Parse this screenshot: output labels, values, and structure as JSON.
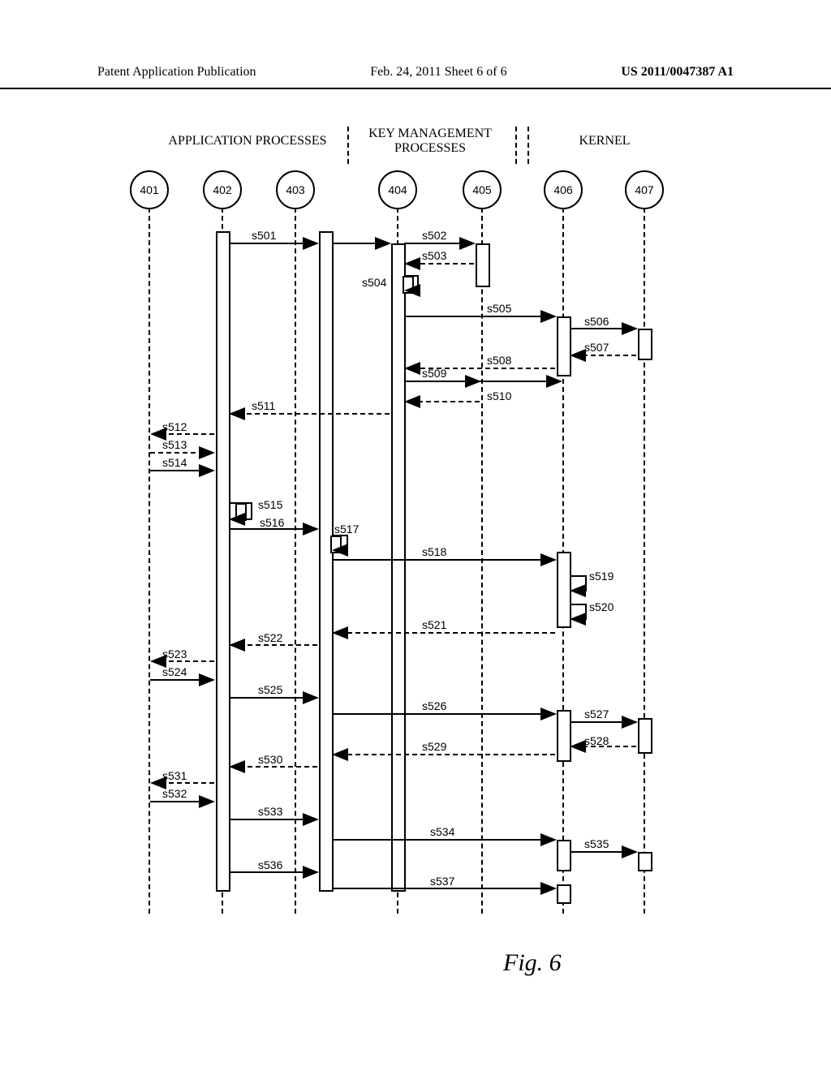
{
  "header": {
    "left": "Patent Application Publication",
    "center": "Feb. 24, 2011  Sheet 6 of 6",
    "right": "US 2011/0047387 A1"
  },
  "sections": {
    "app": "APPLICATION PROCESSES",
    "key": "KEY MANAGEMENT\nPROCESSES",
    "kernel": "KERNEL"
  },
  "lifelines": {
    "l401": "401",
    "l402": "402",
    "l403": "403",
    "l404": "404",
    "l405": "405",
    "l406": "406",
    "l407": "407"
  },
  "messages": {
    "s501": "s501",
    "s502": "s502",
    "s503": "s503",
    "s504": "s504",
    "s505": "s505",
    "s506": "s506",
    "s507": "s507",
    "s508": "s508",
    "s509": "s509",
    "s510": "s510",
    "s511": "s511",
    "s512": "s512",
    "s513": "s513",
    "s514": "s514",
    "s515": "s515",
    "s516": "s516",
    "s517": "s517",
    "s518": "s518",
    "s519": "s519",
    "s520": "s520",
    "s521": "s521",
    "s522": "s522",
    "s523": "s523",
    "s524": "s524",
    "s525": "s525",
    "s526": "s526",
    "s527": "s527",
    "s528": "s528",
    "s529": "s529",
    "s530": "s530",
    "s531": "s531",
    "s532": "s532",
    "s533": "s533",
    "s534": "s534",
    "s535": "s535",
    "s536": "s536",
    "s537": "s537"
  },
  "figure_caption": "Fig. 6"
}
